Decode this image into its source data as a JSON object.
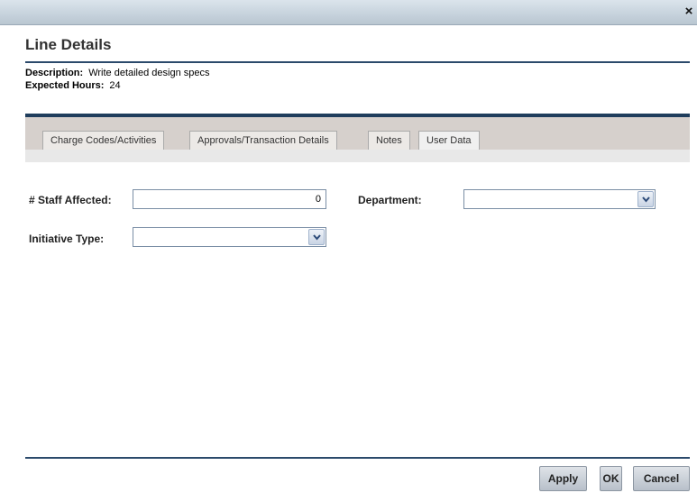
{
  "window": {
    "close_glyph": "×"
  },
  "dialog": {
    "title": "Line Details",
    "description_label": "Description:",
    "description_value": "Write detailed design specs",
    "expected_hours_label": "Expected Hours:",
    "expected_hours_value": "24"
  },
  "tabs": [
    {
      "label": "Charge Codes/Activities",
      "active": false
    },
    {
      "label": "Approvals/Transaction Details",
      "active": false
    },
    {
      "label": "Notes",
      "active": false
    },
    {
      "label": "User Data",
      "active": true
    }
  ],
  "form": {
    "staff_affected_label": "# Staff Affected:",
    "staff_affected_value": "0",
    "department_label": "Department:",
    "department_value": "",
    "initiative_type_label": "Initiative Type:",
    "initiative_type_value": ""
  },
  "buttons": {
    "apply": "Apply",
    "ok": "OK",
    "cancel": "Cancel"
  },
  "colors": {
    "accent_rule": "#2b4a6b",
    "tab_bar": "#d6d0cc",
    "input_border": "#7a8ea5"
  },
  "icons": {
    "close": "close-icon",
    "dropdown": "chevron-down-icon"
  }
}
